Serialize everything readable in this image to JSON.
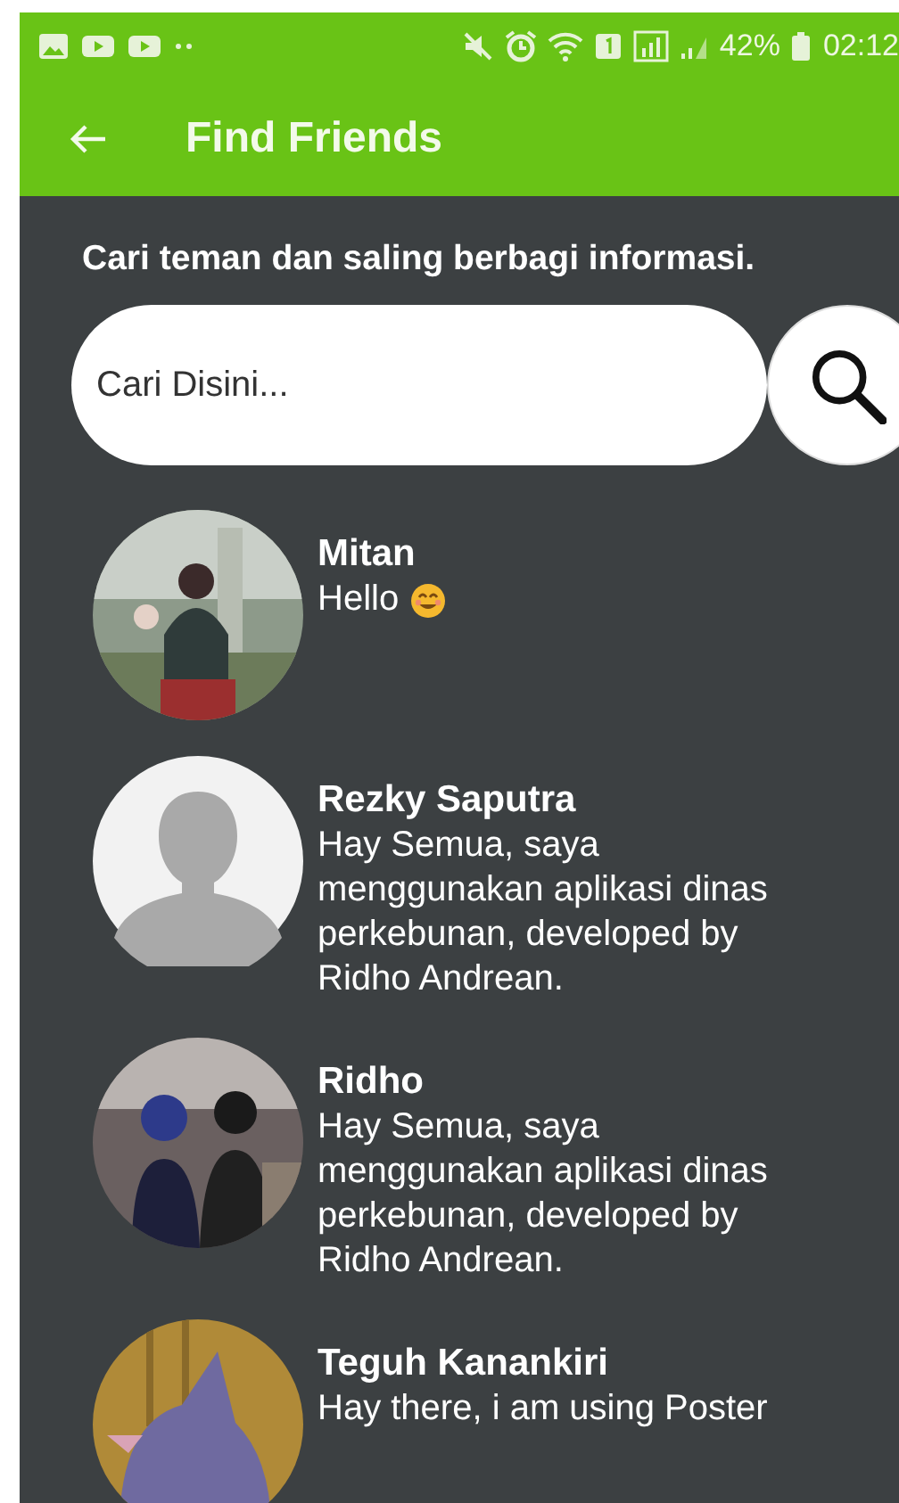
{
  "status_bar": {
    "battery": "42%",
    "time": "02:12"
  },
  "app_bar": {
    "title": "Find Friends"
  },
  "intro": "Cari teman dan saling berbagi informasi.",
  "search": {
    "placeholder": "Cari Disini..."
  },
  "friends": [
    {
      "name": "Mitan",
      "message": "Hello",
      "has_emoji": true
    },
    {
      "name": "Rezky Saputra",
      "message": "Hay Semua, saya menggunakan aplikasi dinas perkebunan, developed by Ridho Andrean.",
      "has_emoji": false,
      "avatar": {
        "kind": "silhouette"
      }
    },
    {
      "name": "Ridho",
      "message": "Hay Semua, saya menggunakan aplikasi dinas perkebunan, developed by Ridho Andrean.",
      "has_emoji": false
    },
    {
      "name": "Teguh Kanankiri",
      "message": "Hay there, i am using Poster",
      "has_emoji": false
    }
  ]
}
